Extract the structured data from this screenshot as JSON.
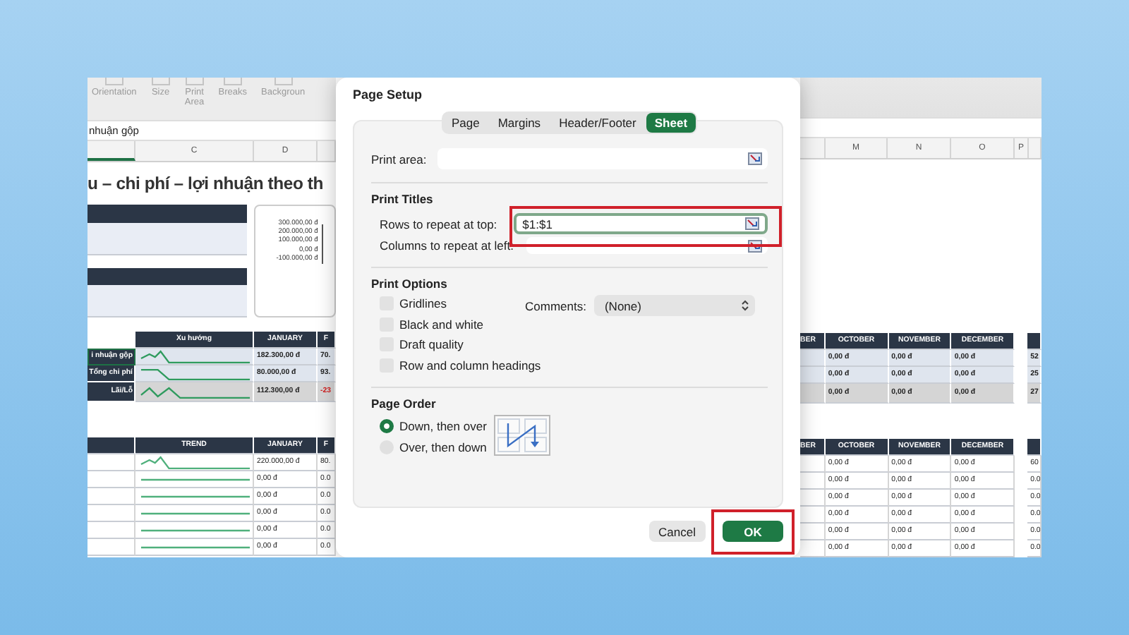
{
  "ribbon": {
    "items": [
      {
        "label": "Orientation"
      },
      {
        "label": "Size"
      },
      {
        "label": "Print Area"
      },
      {
        "label": "Breaks"
      },
      {
        "label": "Backgroun"
      }
    ]
  },
  "formula_bar": {
    "value": "nhuận gộp"
  },
  "left_pane": {
    "column_headers": [
      "C",
      "D"
    ],
    "title": "u – chi phí – lợi nhuận theo th",
    "chart_axis_labels": [
      "300.000,00 đ",
      "200.000,00 đ",
      "100.000,00 đ",
      "0,00 đ",
      "-100.000,00 đ"
    ],
    "table_1": {
      "columns": [
        "",
        "Xu hướng",
        "JANUARY",
        "F"
      ],
      "rows": [
        {
          "cells": [
            {
              "text": "i nhuận gộp",
              "negative": false
            },
            {
              "text": "",
              "negative": false
            },
            {
              "text": "182.300,00 đ",
              "negative": false
            },
            {
              "text": "70.",
              "negative": false
            }
          ]
        },
        {
          "cells": [
            {
              "text": "Tổng chi phí",
              "negative": false
            },
            {
              "text": "",
              "negative": false
            },
            {
              "text": "80.000,00 đ",
              "negative": false
            },
            {
              "text": "93.",
              "negative": false
            }
          ]
        },
        {
          "cells": [
            {
              "text": "Lãi/Lỗ",
              "negative": false
            },
            {
              "text": "",
              "negative": false
            },
            {
              "text": "112.300,00 đ",
              "negative": false
            },
            {
              "text": "-23",
              "negative": true
            }
          ]
        }
      ]
    },
    "table_2": {
      "columns": [
        "",
        "TREND",
        "JANUARY",
        "F"
      ],
      "rows": [
        {
          "cells": [
            "",
            "",
            "220.000,00 đ",
            "80."
          ]
        },
        {
          "cells": [
            "",
            "",
            "0,00 đ",
            "0.0"
          ]
        },
        {
          "cells": [
            "",
            "",
            "0,00 đ",
            "0.0"
          ]
        },
        {
          "cells": [
            "",
            "",
            "0,00 đ",
            "0.0"
          ]
        },
        {
          "cells": [
            "",
            "",
            "0,00 đ",
            "0.0"
          ]
        },
        {
          "cells": [
            "",
            "",
            "0,00 đ",
            "0.0"
          ]
        }
      ]
    }
  },
  "right_pane": {
    "column_headers": [
      "M",
      "N",
      "O",
      "P"
    ],
    "table_1": {
      "columns": [
        "BER",
        "OCTOBER",
        "NOVEMBER",
        "DECEMBER"
      ],
      "rows": [
        {
          "cells": [
            "",
            "0,00 đ",
            "0,00 đ",
            "0,00 đ"
          ],
          "extra": "52"
        },
        {
          "cells": [
            "",
            "0,00 đ",
            "0,00 đ",
            "0,00 đ"
          ],
          "extra": "25"
        },
        {
          "cells": [
            "",
            "0,00 đ",
            "0,00 đ",
            "0,00 đ"
          ],
          "extra": "27"
        }
      ]
    },
    "table_2": {
      "columns": [
        "BER",
        "OCTOBER",
        "NOVEMBER",
        "DECEMBER"
      ],
      "rows": [
        {
          "cells": [
            "",
            "0,00 đ",
            "0,00 đ",
            "0,00 đ"
          ],
          "extra": "60"
        },
        {
          "cells": [
            "",
            "0,00 đ",
            "0,00 đ",
            "0,00 đ"
          ],
          "extra": "0.0"
        },
        {
          "cells": [
            "",
            "0,00 đ",
            "0,00 đ",
            "0,00 đ"
          ],
          "extra": "0.0"
        },
        {
          "cells": [
            "",
            "0,00 đ",
            "0,00 đ",
            "0,00 đ"
          ],
          "extra": "0.0"
        },
        {
          "cells": [
            "",
            "0,00 đ",
            "0,00 đ",
            "0,00 đ"
          ],
          "extra": "0.0"
        },
        {
          "cells": [
            "",
            "0,00 đ",
            "0,00 đ",
            "0,00 đ"
          ],
          "extra": "0.0"
        }
      ]
    }
  },
  "dialog": {
    "title": "Page Setup",
    "tabs": [
      {
        "label": "Page",
        "selected": false
      },
      {
        "label": "Margins",
        "selected": false
      },
      {
        "label": "Header/Footer",
        "selected": false
      },
      {
        "label": "Sheet",
        "selected": true
      }
    ],
    "print_area": {
      "label": "Print area:"
    },
    "print_titles": {
      "heading": "Print Titles",
      "rows": {
        "label": "Rows to repeat at top:",
        "value": "$1:$1",
        "highlighted": true
      },
      "columns": {
        "label": "Columns to repeat at left:"
      }
    },
    "print_options": {
      "heading": "Print Options",
      "checkboxes": [
        {
          "label": "Gridlines",
          "checked": false
        },
        {
          "label": "Black and white",
          "checked": false
        },
        {
          "label": "Draft quality",
          "checked": false
        },
        {
          "label": "Row and column headings",
          "checked": false
        }
      ],
      "comments": {
        "label": "Comments:",
        "value": "(None)"
      }
    },
    "page_order": {
      "heading": "Page Order",
      "options": [
        {
          "label": "Down, then over",
          "selected": true
        },
        {
          "label": "Over, then down",
          "selected": false
        }
      ]
    },
    "buttons": [
      {
        "label": "Cancel",
        "kind": "secondary",
        "highlighted": false
      },
      {
        "label": "OK",
        "kind": "primary",
        "highlighted": true
      }
    ]
  }
}
